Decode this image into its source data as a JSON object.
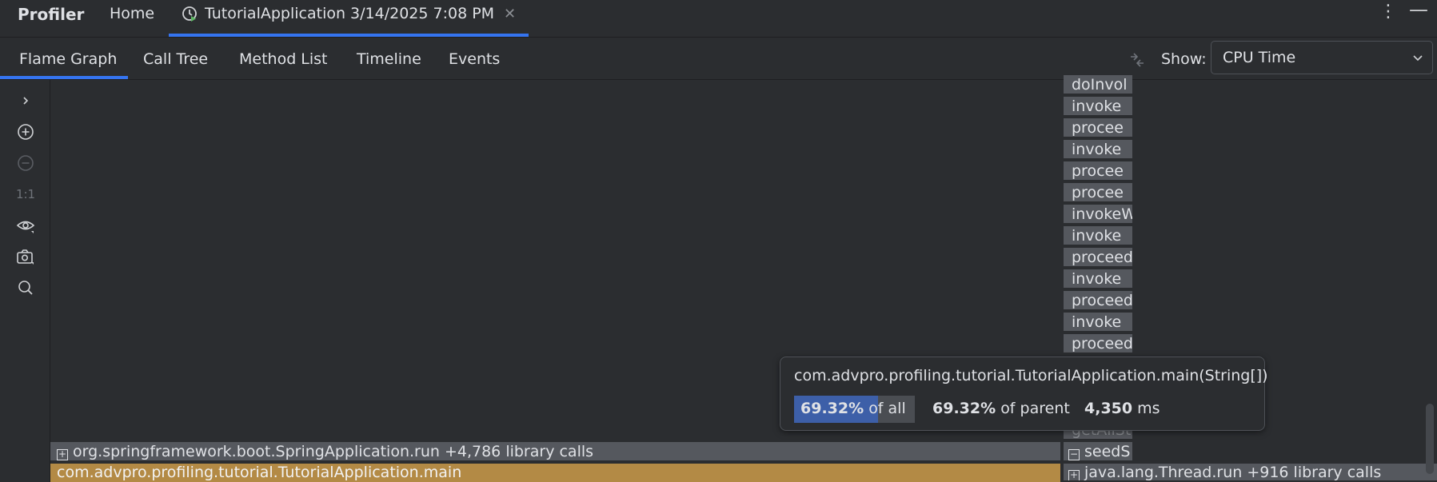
{
  "header": {
    "app_title": "Profiler",
    "home_tab": "Home",
    "session_tab": "TutorialApplication 3/14/2025 7:08 PM",
    "session_icon": "profiler-clock-icon",
    "close_icon": "close-icon",
    "menu_icon": "more-vertical-icon",
    "minimize_icon": "minimize-icon"
  },
  "tabs": [
    {
      "label": "Flame Graph"
    },
    {
      "label": "Call Tree"
    },
    {
      "label": "Method List"
    },
    {
      "label": "Timeline"
    },
    {
      "label": "Events"
    }
  ],
  "show": {
    "label": "Show:",
    "value": "CPU Time"
  },
  "toolbar": {
    "reset_zoom": "1:1"
  },
  "flame": {
    "stack_column": [
      "doInvol",
      "invoke",
      "procee",
      "invoke",
      "procee",
      "procee",
      "invokeW",
      "invoke",
      "proceed",
      "invoke",
      "proceed",
      "invoke",
      "proceed"
    ],
    "partial_frame": "getAllSt",
    "seed_frame": "seedS",
    "spring_frame": "org.springframework.boot.SpringApplication.run  +4,786 library calls",
    "main_frame": "com.advpro.profiling.tutorial.TutorialApplication.main",
    "thread_frame": "java.lang.Thread.run  +916 library calls"
  },
  "tooltip": {
    "title": "com.advpro.profiling.tutorial.TutorialApplication.main(String[])",
    "of_all_pct": "69.32%",
    "of_all_fraction": 0.6932,
    "of_all_label": "of all",
    "of_parent_pct": "69.32%",
    "of_parent_label": "of parent",
    "time_value": "4,350",
    "time_unit": "ms"
  }
}
